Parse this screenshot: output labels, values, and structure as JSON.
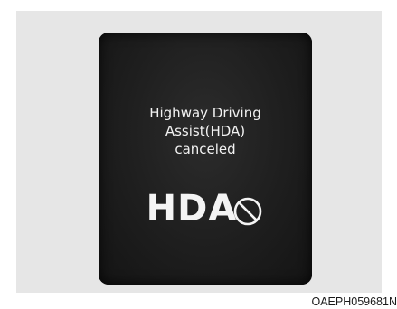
{
  "display": {
    "message_lines": [
      "Highway Driving",
      "Assist(HDA)",
      "canceled"
    ],
    "indicator_text": "HDA",
    "indicator_icon": "cancel-prohibited-icon",
    "colors": {
      "screen": "#1e1e1e",
      "text": "#f2f2f2",
      "panel": "#e6e6e6"
    }
  },
  "caption": "OAEPH059681N"
}
